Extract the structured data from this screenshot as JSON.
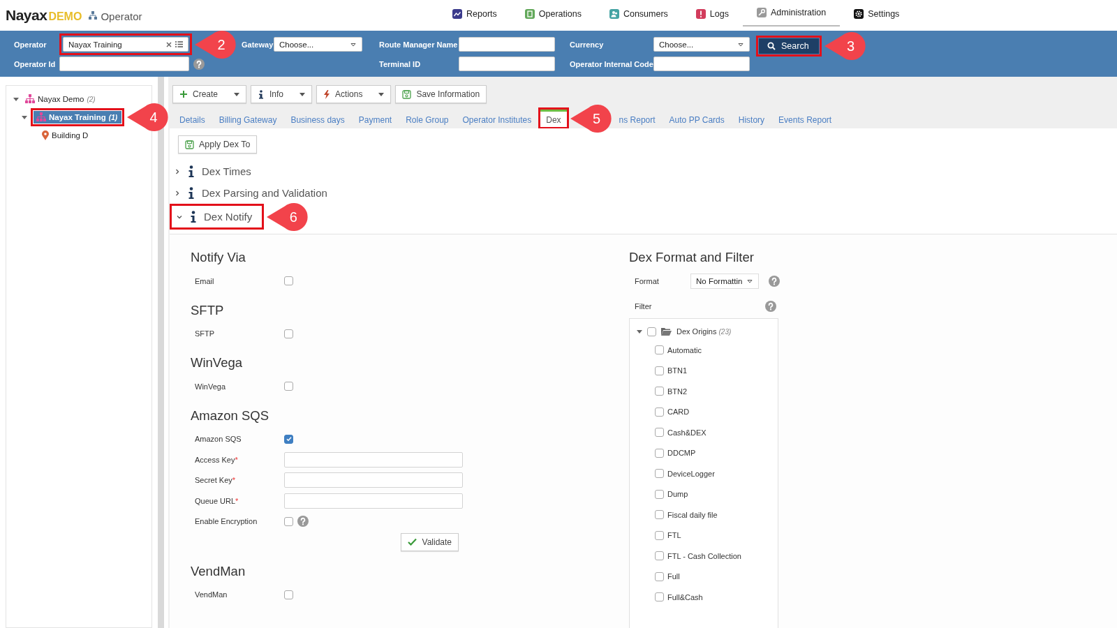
{
  "header": {
    "logo": "Nayax",
    "logo_suffix": "DEMO",
    "section": "Operator",
    "nav": [
      {
        "label": "Reports",
        "kind": "reports",
        "selected": false
      },
      {
        "label": "Operations",
        "kind": "operations",
        "selected": false
      },
      {
        "label": "Consumers",
        "kind": "consumers",
        "selected": false
      },
      {
        "label": "Logs",
        "kind": "logs",
        "selected": false
      },
      {
        "label": "Administration",
        "kind": "administration",
        "selected": true
      },
      {
        "label": "Settings",
        "kind": "settings",
        "selected": false
      }
    ]
  },
  "filter_bar": {
    "columns": [
      {
        "rows": [
          {
            "label": "Operator",
            "control": {
              "kind": "lookup",
              "value": "Nayax Training",
              "callout": "2"
            }
          },
          {
            "label": "Operator Id",
            "control": {
              "kind": "input",
              "help": true
            }
          }
        ]
      },
      {
        "rows": [
          {
            "label": "Gateway",
            "control": {
              "kind": "select",
              "value": "Choose..."
            }
          }
        ]
      },
      {
        "rows": [
          {
            "label": "Route Manager Name",
            "control": {
              "kind": "input"
            }
          },
          {
            "label": "Terminal ID",
            "control": {
              "kind": "input"
            }
          }
        ]
      },
      {
        "rows": [
          {
            "label": "Currency",
            "control": {
              "kind": "select",
              "value": "Choose..."
            }
          },
          {
            "label": "Operator Internal Code",
            "control": {
              "kind": "input"
            }
          }
        ]
      }
    ],
    "search_button": {
      "label": "Search",
      "callout": "3"
    }
  },
  "sidebar": {
    "tree": [
      {
        "label": "Nayax Demo",
        "count": "(2)",
        "kind": "organization",
        "expanded": true,
        "selected": false,
        "children": [
          {
            "label": "Nayax Training",
            "count": "(1)",
            "kind": "organization",
            "expanded": true,
            "selected": true,
            "callout": "4",
            "children": [
              {
                "label": "Building D",
                "kind": "location",
                "selected": false
              }
            ]
          }
        ]
      }
    ]
  },
  "toolbar": [
    {
      "label": "Create",
      "kind": "create",
      "dropdown": true
    },
    {
      "label": "Info",
      "kind": "info",
      "dropdown": true
    },
    {
      "label": "Actions",
      "kind": "actions",
      "dropdown": true
    },
    {
      "label": "Save Information",
      "kind": "save",
      "dropdown": false
    }
  ],
  "tabs": [
    {
      "label": "Details",
      "selected": false
    },
    {
      "label": "Billing Gateway",
      "selected": false
    },
    {
      "label": "Business days",
      "selected": false
    },
    {
      "label": "Payment",
      "selected": false
    },
    {
      "label": "Role Group",
      "selected": false
    },
    {
      "label": "Operator Institutes",
      "selected": false
    },
    {
      "label": "Dex",
      "selected": true,
      "callout": "5"
    },
    {
      "label": "ns Report",
      "selected": false
    },
    {
      "label": "Auto PP Cards",
      "selected": false
    },
    {
      "label": "History",
      "selected": false
    },
    {
      "label": "Events Report",
      "selected": false
    }
  ],
  "apply_button": "Apply Dex To",
  "sections": [
    {
      "title": "Dex Times",
      "expanded": false
    },
    {
      "title": "Dex Parsing and Validation",
      "expanded": false
    },
    {
      "title": "Dex Notify",
      "expanded": true,
      "callout": "6"
    }
  ],
  "notify_groups": [
    {
      "title": "Notify Via",
      "rows": [
        {
          "kind": "checkbox",
          "label": "Email",
          "checked": false
        }
      ]
    },
    {
      "title": "SFTP",
      "rows": [
        {
          "kind": "checkbox",
          "label": "SFTP",
          "checked": false
        }
      ]
    },
    {
      "title": "WinVega",
      "rows": [
        {
          "kind": "checkbox",
          "label": "WinVega",
          "checked": false
        }
      ]
    },
    {
      "title": "Amazon SQS",
      "rows": [
        {
          "kind": "checkbox",
          "label": "Amazon SQS",
          "checked": true
        },
        {
          "kind": "input",
          "label": "Access Key",
          "required_mark": "*"
        },
        {
          "kind": "input",
          "label": "Secret Key",
          "required_mark": "*"
        },
        {
          "kind": "input",
          "label": "Queue URL",
          "required_mark": "*"
        },
        {
          "kind": "checkbox",
          "label": "Enable Encryption",
          "checked": false,
          "help": true
        },
        {
          "kind": "button",
          "label": "Validate"
        }
      ]
    },
    {
      "title": "VendMan",
      "rows": [
        {
          "kind": "checkbox",
          "label": "VendMan",
          "checked": false
        }
      ]
    }
  ],
  "format_filter": {
    "title": "Dex Format and Filter",
    "format_label": "Format",
    "format_value": "No Formattin",
    "filter_label": "Filter",
    "tree": {
      "label": "Dex Origins",
      "count": "(23)",
      "expanded": true,
      "checked": false,
      "children": [
        {
          "label": "Automatic",
          "checked": false
        },
        {
          "label": "BTN1",
          "checked": false
        },
        {
          "label": "BTN2",
          "checked": false
        },
        {
          "label": "CARD",
          "checked": false
        },
        {
          "label": "Cash&DEX",
          "checked": false
        },
        {
          "label": "DDCMP",
          "checked": false
        },
        {
          "label": "DeviceLogger",
          "checked": false
        },
        {
          "label": "Dump",
          "checked": false
        },
        {
          "label": "Fiscal daily file",
          "checked": false
        },
        {
          "label": "FTL",
          "checked": false
        },
        {
          "label": "FTL - Cash Collection",
          "checked": false
        },
        {
          "label": "Full",
          "checked": false
        },
        {
          "label": "Full&Cash",
          "checked": false
        }
      ]
    }
  }
}
